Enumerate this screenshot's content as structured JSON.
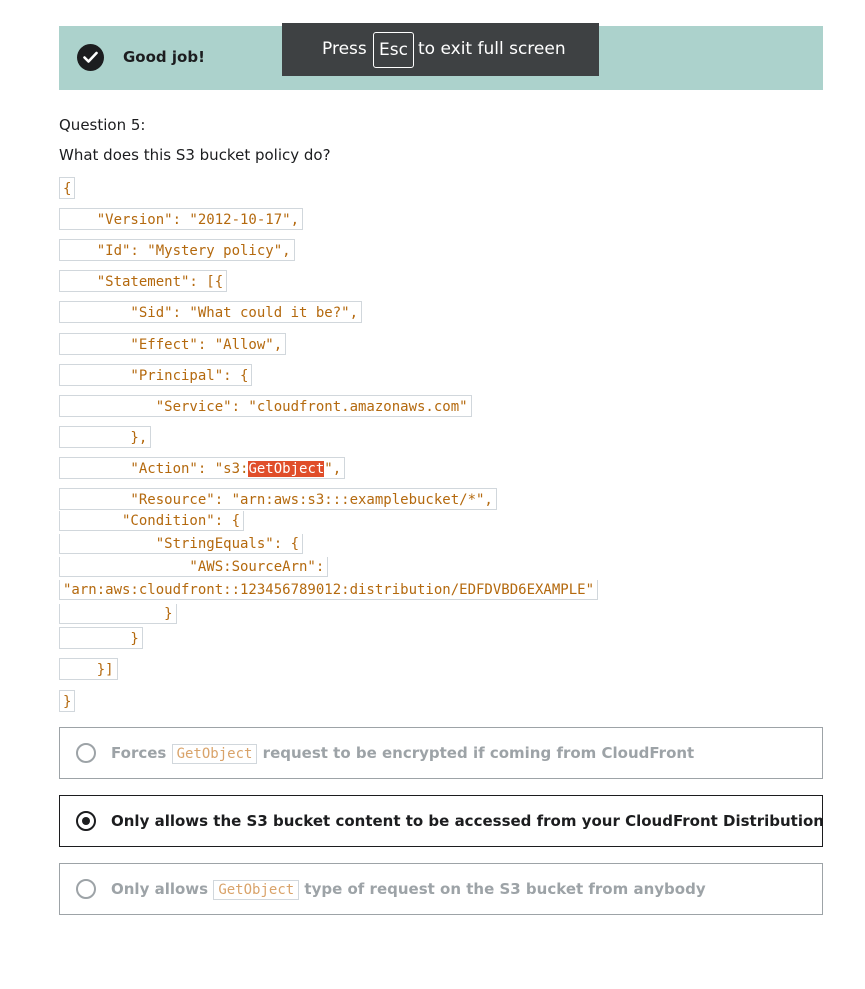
{
  "banner": {
    "text": "Good job!",
    "icon": "check-circle-icon",
    "color": "#acd2cc"
  },
  "fullscreen_notice": {
    "before": "Press",
    "key": "Esc",
    "after": "to exit full screen"
  },
  "question": {
    "number_label": "Question 5:",
    "text": "What does this S3 bucket policy do?"
  },
  "code_lines": [
    "{",
    "    \"Version\": \"2012-10-17\",",
    "    \"Id\": \"Mystery policy\",",
    "    \"Statement\": [{",
    "        \"Sid\": \"What could it be?\",",
    "        \"Effect\": \"Allow\",",
    "        \"Principal\": {",
    "           \"Service\": \"cloudfront.amazonaws.com\"",
    "        },",
    "        \"Action\": \"s3:",
    "GetObject",
    "\",",
    "        \"Resource\": \"arn:aws:s3:::examplebucket/*\",",
    "       \"Condition\": {",
    "           \"StringEquals\": {",
    "               \"AWS:SourceArn\":",
    "\"arn:aws:cloudfront::123456789012:distribution/EDFDVBD6EXAMPLE\"",
    "            }",
    "        }",
    "    }]",
    "}"
  ],
  "options": [
    {
      "before": "Forces",
      "code": "GetObject",
      "after": "request to be encrypted if coming from CloudFront",
      "selected": false
    },
    {
      "before": "Only allows the S3 bucket content to be accessed from your CloudFront Distribution",
      "code": "",
      "after": "",
      "selected": true
    },
    {
      "before": "Only allows",
      "code": "GetObject",
      "after": "type of request on the S3 bucket from anybody",
      "selected": false
    }
  ]
}
